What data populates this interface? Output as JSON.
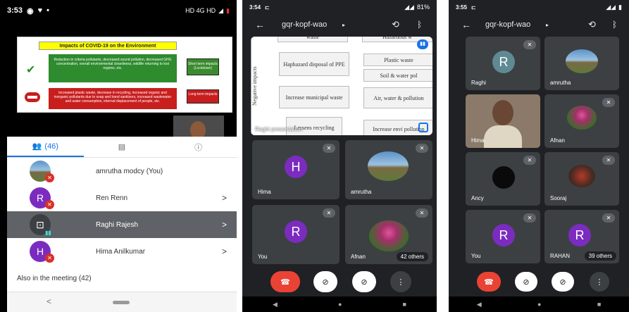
{
  "phone1": {
    "time": "3:53",
    "status_right": "HD 4G HD",
    "slide": {
      "title": "Impacts of COVID-19 on the Environment",
      "green_text": "Reduction in criteria pollutants, decreased sound pollution, decreased GHG concentration, overall environmental cleanliness, wildlife returning to lost regions, etc.",
      "red_text": "Increased plastic waste, decrease in recycling, increased organic and inorganic pollutants due to soap and hand sanitizers, increased wastewater and water consumption, internal displacement of people, etc.",
      "short_label": "Short term impacts (Lockdown)",
      "long_label": "Long term impacts"
    },
    "tabs": {
      "people_count": "(46)"
    },
    "participants": [
      {
        "name": "amrutha modcy (You)"
      },
      {
        "name": "Ren Renn",
        "initial": "R"
      },
      {
        "name": "Raghi Rajesh"
      },
      {
        "name": "Hima Anilkumar",
        "initial": "H"
      }
    ],
    "also_label": "Also in the meeting (42)"
  },
  "phone2": {
    "time": "3:54",
    "battery": "81%",
    "meeting_code": "gqr-kopf-wao",
    "presentation_label": "Raghi presentation",
    "slide": {
      "side": "Negative impacts",
      "b1": "Haphazard disposal of PPE",
      "b2": "Increase municipal waste",
      "b3": "Lessens recycling",
      "r1": "Plastic waste",
      "r2": "Soil & water pol",
      "r3": "Air, water & pollution",
      "r4": "Increase envi pollution",
      "top_l": "waste",
      "top_r": "Hazardous w"
    },
    "tiles": [
      {
        "name": "Hima",
        "initial": "H"
      },
      {
        "name": "amrutha"
      },
      {
        "name": "You",
        "initial": "R"
      },
      {
        "name": "Afnan"
      }
    ],
    "others": "42 others"
  },
  "phone3": {
    "time": "3:55",
    "meeting_code": "gqr-kopf-wao",
    "tiles": [
      {
        "name": "Raghi",
        "initial": "R"
      },
      {
        "name": "amrutha"
      },
      {
        "name": "Hima"
      },
      {
        "name": "Afnan"
      },
      {
        "name": "Ancy"
      },
      {
        "name": "Sooraj"
      },
      {
        "name": "You",
        "initial": "R"
      },
      {
        "name": "RAHAN",
        "initial": "R"
      }
    ],
    "others": "39 others"
  },
  "colors": {
    "dark_bg": "#202124",
    "tile": "#3c4043",
    "purple": "#7b2cbf",
    "end_call": "#ea4335",
    "teal": "#5f8a94"
  }
}
